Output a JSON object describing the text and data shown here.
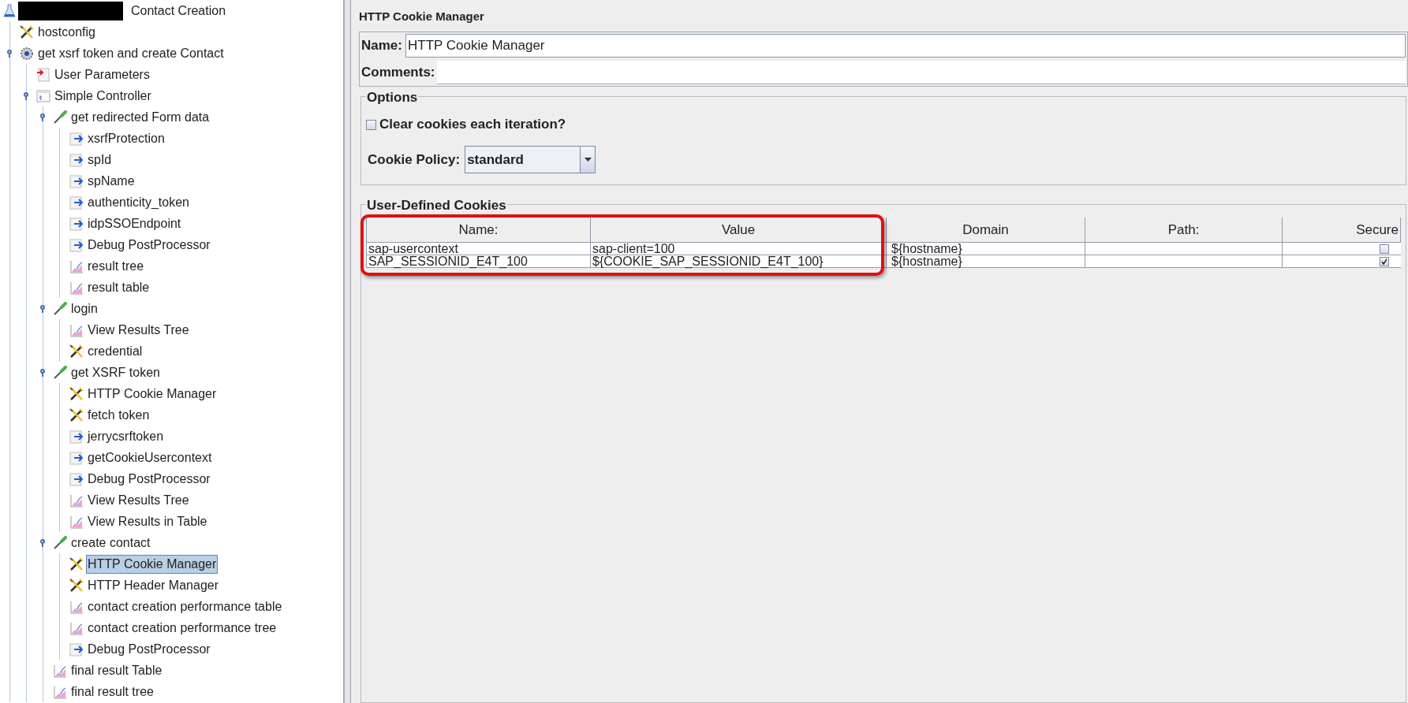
{
  "tree": [
    {
      "label": "Contact Creation",
      "kind": "testplan",
      "redacted": true,
      "children": [
        {
          "label": "hostconfig",
          "kind": "config",
          "selected": false
        },
        {
          "label": "get xsrf token and create Contact",
          "kind": "threadgroup",
          "expanded": true,
          "selected": false,
          "children": [
            {
              "label": "User Parameters",
              "kind": "preprocessor",
              "selected": false
            },
            {
              "label": "Simple Controller",
              "kind": "controller",
              "expanded": true,
              "selected": false,
              "children": [
                {
                  "label": "get redirected Form data",
                  "kind": "sampler",
                  "expanded": true,
                  "selected": false,
                  "children": [
                    {
                      "label": "xsrfProtection",
                      "kind": "postprocessor",
                      "selected": false
                    },
                    {
                      "label": "spId",
                      "kind": "postprocessor",
                      "selected": false
                    },
                    {
                      "label": "spName",
                      "kind": "postprocessor",
                      "selected": false
                    },
                    {
                      "label": "authenticity_token",
                      "kind": "postprocessor",
                      "selected": false
                    },
                    {
                      "label": "idpSSOEndpoint",
                      "kind": "postprocessor",
                      "selected": false
                    },
                    {
                      "label": "Debug PostProcessor",
                      "kind": "postprocessor",
                      "selected": false
                    },
                    {
                      "label": "result tree",
                      "kind": "listener",
                      "selected": false
                    },
                    {
                      "label": "result table",
                      "kind": "listener",
                      "selected": false
                    }
                  ]
                },
                {
                  "label": "login",
                  "kind": "sampler",
                  "expanded": true,
                  "selected": false,
                  "children": [
                    {
                      "label": "View Results Tree",
                      "kind": "listener",
                      "selected": false
                    },
                    {
                      "label": "credential",
                      "kind": "config",
                      "selected": false
                    }
                  ]
                },
                {
                  "label": "get XSRF token",
                  "kind": "sampler",
                  "expanded": true,
                  "selected": false,
                  "children": [
                    {
                      "label": "HTTP Cookie Manager",
                      "kind": "config",
                      "selected": false
                    },
                    {
                      "label": "fetch token",
                      "kind": "config",
                      "selected": false
                    },
                    {
                      "label": "jerrycsrftoken",
                      "kind": "postprocessor",
                      "selected": false
                    },
                    {
                      "label": "getCookieUsercontext",
                      "kind": "postprocessor",
                      "selected": false
                    },
                    {
                      "label": "Debug PostProcessor",
                      "kind": "postprocessor",
                      "selected": false
                    },
                    {
                      "label": "View Results Tree",
                      "kind": "listener",
                      "selected": false
                    },
                    {
                      "label": "View Results in Table",
                      "kind": "listener",
                      "selected": false
                    }
                  ]
                },
                {
                  "label": "create contact",
                  "kind": "sampler",
                  "expanded": true,
                  "selected": false,
                  "children": [
                    {
                      "label": "HTTP Cookie Manager",
                      "kind": "config",
                      "selected": true
                    },
                    {
                      "label": "HTTP Header Manager",
                      "kind": "config",
                      "selected": false
                    },
                    {
                      "label": "contact creation performance table",
                      "kind": "listener",
                      "selected": false
                    },
                    {
                      "label": "contact creation performance tree",
                      "kind": "listener",
                      "selected": false
                    },
                    {
                      "label": "Debug PostProcessor",
                      "kind": "postprocessor",
                      "selected": false
                    }
                  ]
                },
                {
                  "label": "final result Table",
                  "kind": "listener",
                  "selected": false
                },
                {
                  "label": "final result tree",
                  "kind": "listener",
                  "selected": false
                }
              ]
            }
          ]
        }
      ]
    }
  ],
  "panel": {
    "title": "HTTP Cookie Manager",
    "name_label": "Name:",
    "name_value": "HTTP Cookie Manager",
    "comments_label": "Comments:",
    "options": {
      "title": "Options",
      "clear_cookies": {
        "label": "Clear cookies each iteration?",
        "checked": false
      },
      "policy_label": "Cookie Policy:",
      "policy_value": "standard"
    },
    "cookies": {
      "title": "User-Defined Cookies",
      "columns": [
        "Name:",
        "Value",
        "Domain",
        "Path:",
        "Secure"
      ],
      "rows": [
        {
          "name": "sap-usercontext",
          "value": "sap-client=100",
          "domain": "${hostname}",
          "secure": false
        },
        {
          "name": "SAP_SESSIONID_E4T_100",
          "value": "${COOKIE_SAP_SESSIONID_E4T_100}",
          "domain": "${hostname}",
          "secure": true
        }
      ],
      "highlighted": true
    }
  }
}
